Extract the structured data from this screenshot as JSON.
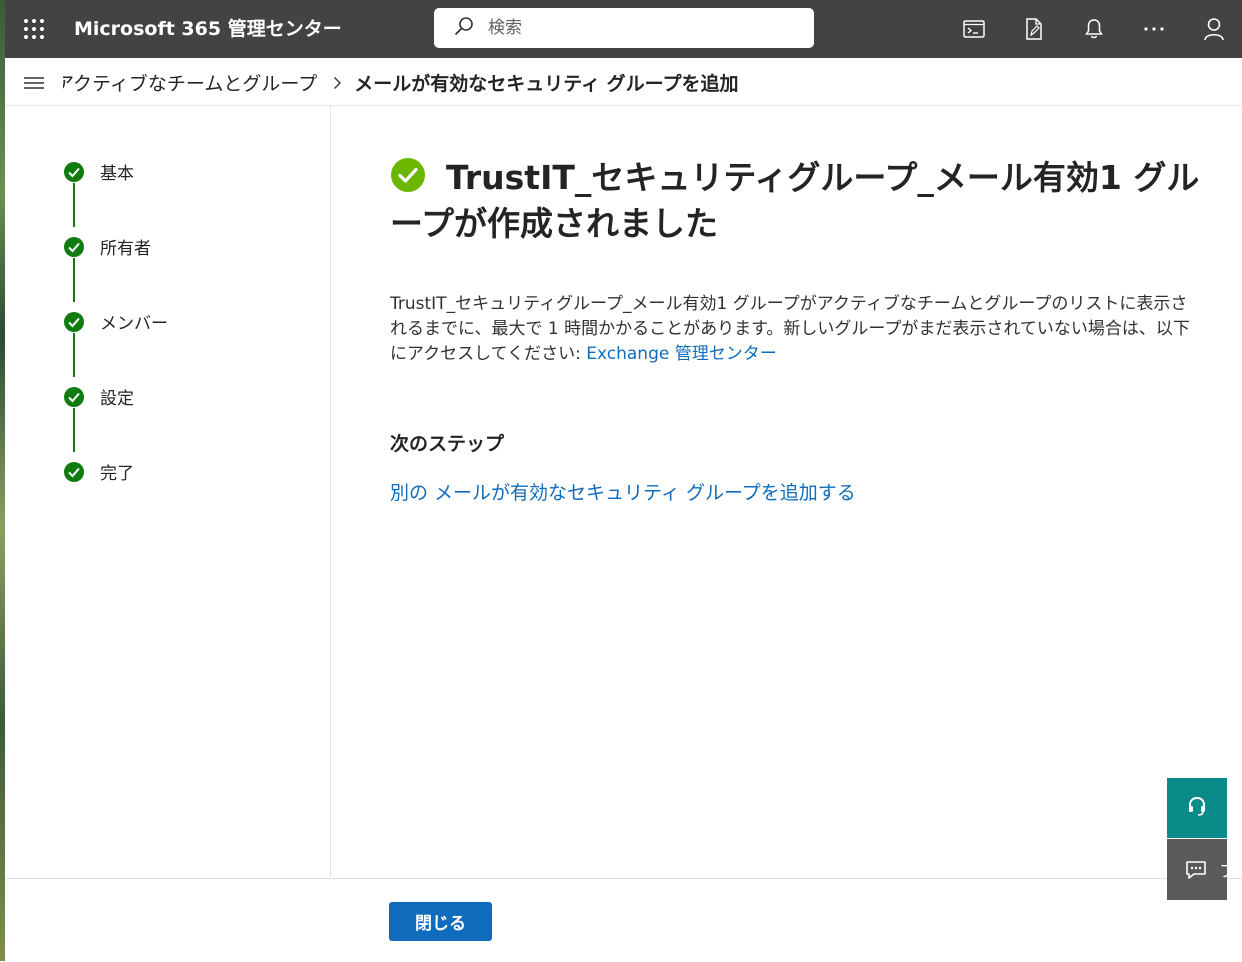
{
  "topbar": {
    "title": "Microsoft 365 管理センター",
    "search_placeholder": "検索"
  },
  "breadcrumb": {
    "parent": "アクティブなチームとグループ",
    "current": "メールが有効なセキュリティ グループを追加"
  },
  "steps": [
    {
      "label": "基本",
      "status": "complete"
    },
    {
      "label": "所有者",
      "status": "complete"
    },
    {
      "label": "メンバー",
      "status": "complete"
    },
    {
      "label": "設定",
      "status": "complete"
    },
    {
      "label": "完了",
      "status": "complete"
    }
  ],
  "main": {
    "heading": "TrustIT_セキュリティグループ_メール有効1 グループが作成されました",
    "description": "TrustIT_セキュリティグループ_メール有効1 グループがアクティブなチームとグループのリストに表示されるまでに、最大で 1 時間かかることがあります。新しいグループがまだ表示されていない場合は、以下にアクセスしてください: ",
    "description_link": "Exchange 管理センター",
    "next_steps_title": "次のステップ",
    "next_steps_link": "別の メールが有効なセキュリティ グループを追加する"
  },
  "footer": {
    "close_label": "閉じる"
  },
  "floating": {
    "feedback_label": "フィードバック"
  },
  "colors": {
    "topbar": "#434343",
    "accent": "#0f6cbd",
    "success": "#107c10",
    "success_heading": "#6bb700",
    "help_button": "#0b8a8a",
    "feedback_button": "#5a5a5a"
  }
}
